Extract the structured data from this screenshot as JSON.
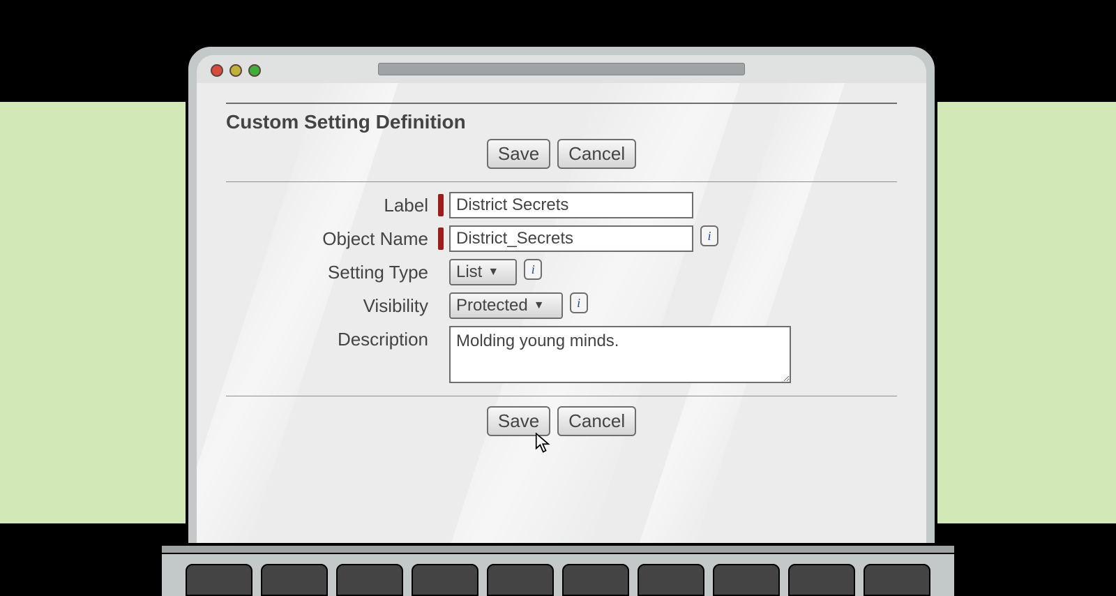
{
  "page": {
    "title": "Custom Setting Definition",
    "buttons": {
      "save": "Save",
      "cancel": "Cancel"
    }
  },
  "form": {
    "labels": {
      "label": "Label",
      "object_name": "Object Name",
      "setting_type": "Setting Type",
      "visibility": "Visibility",
      "description": "Description"
    },
    "values": {
      "label": "District Secrets",
      "object_name": "District_Secrets",
      "setting_type": "List",
      "visibility": "Protected",
      "description": "Molding young minds."
    },
    "info_glyph": "i"
  }
}
